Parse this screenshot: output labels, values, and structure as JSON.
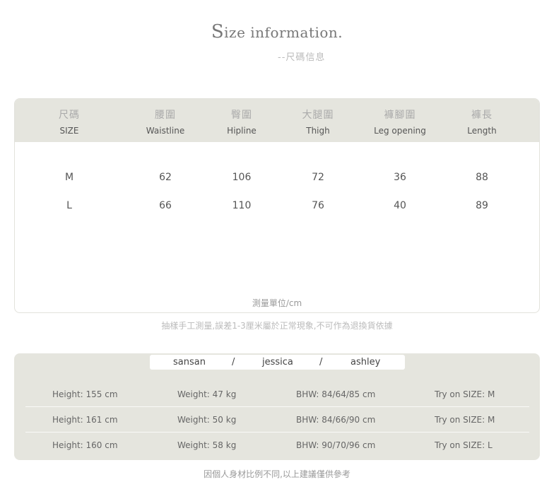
{
  "header": {
    "title_initial": "S",
    "title_rest": "ize information.",
    "subtitle": "--尺碼信息"
  },
  "size_table": {
    "columns": [
      {
        "cn": "尺碼",
        "en": "SIZE"
      },
      {
        "cn": "腰圍",
        "en": "Waistline"
      },
      {
        "cn": "臀圍",
        "en": "Hipline"
      },
      {
        "cn": "大腿圍",
        "en": "Thigh"
      },
      {
        "cn": "褲腳圍",
        "en": "Leg opening"
      },
      {
        "cn": "褲長",
        "en": "Length"
      }
    ],
    "rows": [
      [
        "M",
        "62",
        "106",
        "72",
        "36",
        "88"
      ],
      [
        "L",
        "66",
        "110",
        "76",
        "40",
        "89"
      ]
    ],
    "unit": "測量單位/cm"
  },
  "measure_note": "抽樣手工測量,誤差1-3厘米屬於正常現象,不可作為退換貨依據",
  "models": {
    "names": [
      "sansan",
      "/",
      "jessica",
      "/",
      "ashley"
    ],
    "rows": [
      {
        "height": "Height: 155 cm",
        "weight": "Weight: 47 kg",
        "bhw": "BHW: 84/64/85 cm",
        "size": "Try on SIZE:  M"
      },
      {
        "height": "Height: 161 cm",
        "weight": "Weight: 50 kg",
        "bhw": "BHW: 84/66/90 cm",
        "size": "Try on SIZE:  M"
      },
      {
        "height": "Height: 160 cm",
        "weight": "Weight: 58 kg",
        "bhw": "BHW: 90/70/96 cm",
        "size": "Try on SIZE:  L"
      }
    ]
  },
  "footer_note": "因個人身材比例不同,以上建議僅供參考"
}
